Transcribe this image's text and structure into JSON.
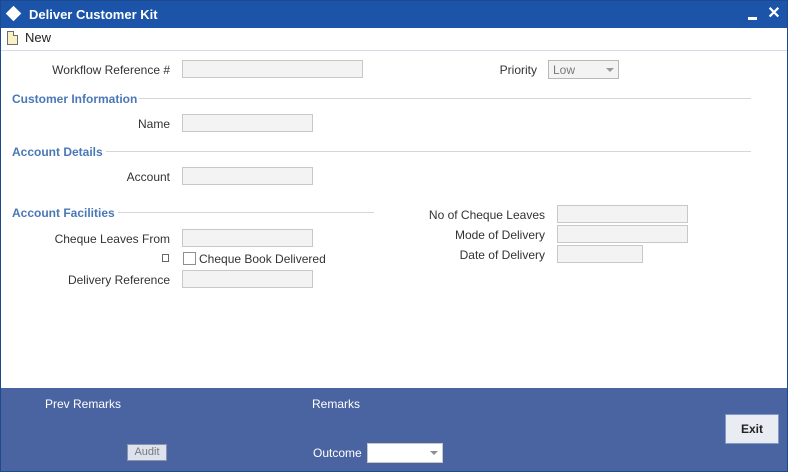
{
  "window": {
    "title": "Deliver Customer Kit",
    "minimize_label": "",
    "close_label": "✕"
  },
  "toolbar": {
    "new_label": "New"
  },
  "form": {
    "workflow_reference_label": "Workflow Reference #",
    "priority_label": "Priority",
    "priority_value": "Low",
    "customer_information_title": "Customer Information",
    "name_label": "Name",
    "account_details_title": "Account Details",
    "account_label": "Account",
    "account_facilities_title": "Account Facilities",
    "cheque_leaves_from_label": "Cheque Leaves From",
    "cheque_book_delivered_label": "Cheque Book Delivered",
    "delivery_reference_label": "Delivery Reference",
    "no_of_cheque_leaves_label": "No of Cheque Leaves",
    "mode_of_delivery_label": "Mode of Delivery",
    "date_of_delivery_label": "Date of Delivery"
  },
  "footer": {
    "prev_remarks_label": "Prev Remarks",
    "remarks_label": "Remarks",
    "audit_label": "Audit",
    "outcome_label": "Outcome",
    "exit_label": "Exit"
  },
  "colors": {
    "titlebar": "#1b54a8",
    "section_title": "#4a78b7",
    "footer": "#4a64a2"
  }
}
